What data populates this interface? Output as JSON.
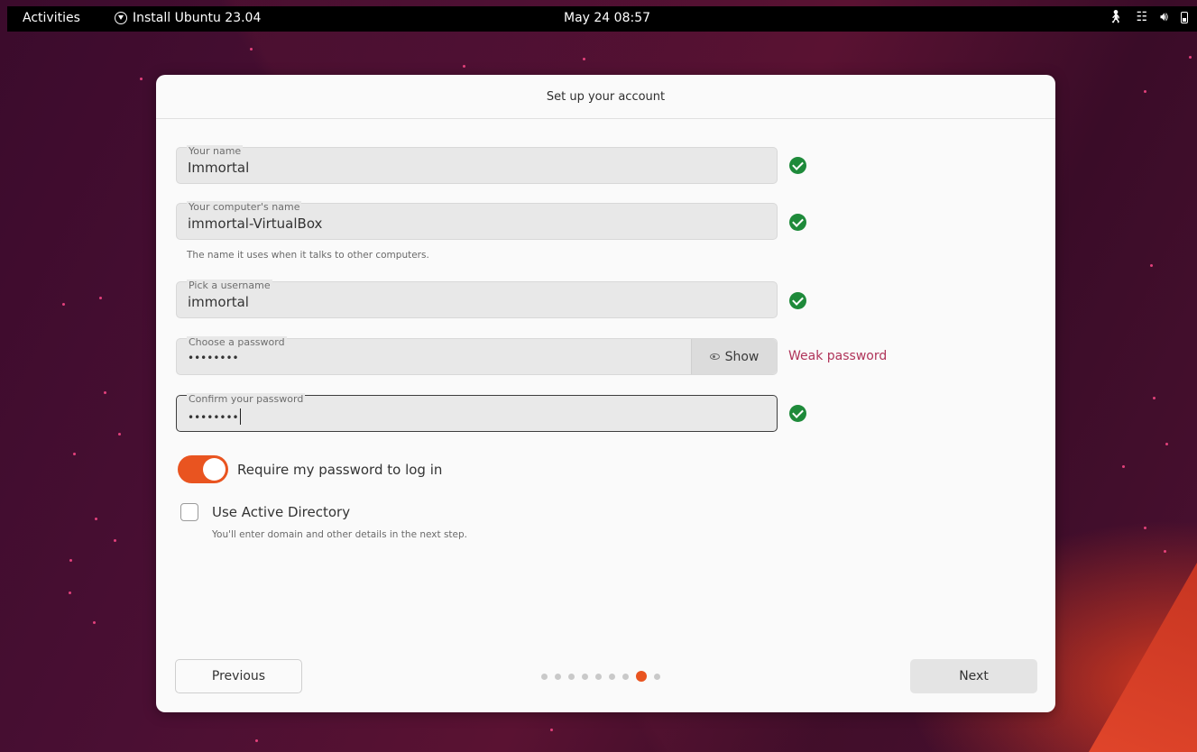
{
  "topbar": {
    "activities": "Activities",
    "app_name": "Install Ubuntu 23.04",
    "clock": "May 24  08:57",
    "tray_icons": [
      "accessibility-icon",
      "network-icon",
      "volume-icon",
      "battery-icon"
    ]
  },
  "dialog": {
    "title": "Set up your account",
    "fields": {
      "name": {
        "label": "Your name",
        "value": "Immortal"
      },
      "computer": {
        "label": "Your computer's name",
        "value": "immortal-VirtualBox",
        "hint": "The name it uses when it talks to other computers."
      },
      "username": {
        "label": "Pick a username",
        "value": "immortal"
      },
      "password": {
        "label": "Choose a password",
        "value": "••••••••",
        "show_label": "Show",
        "strength": "Weak password"
      },
      "confirm": {
        "label": "Confirm your password",
        "value": "••••••••"
      }
    },
    "require_password": {
      "label": "Require my password to log in",
      "checked": true
    },
    "active_directory": {
      "label": "Use Active Directory",
      "hint": "You'll enter domain and other details in the next step.",
      "checked": false
    },
    "previous_label": "Previous",
    "next_label": "Next",
    "progress": {
      "total_steps": 9,
      "current_step": 8
    }
  },
  "colors": {
    "accent": "#e95420",
    "success": "#1e8a3a",
    "warning_text": "#b0345a"
  }
}
